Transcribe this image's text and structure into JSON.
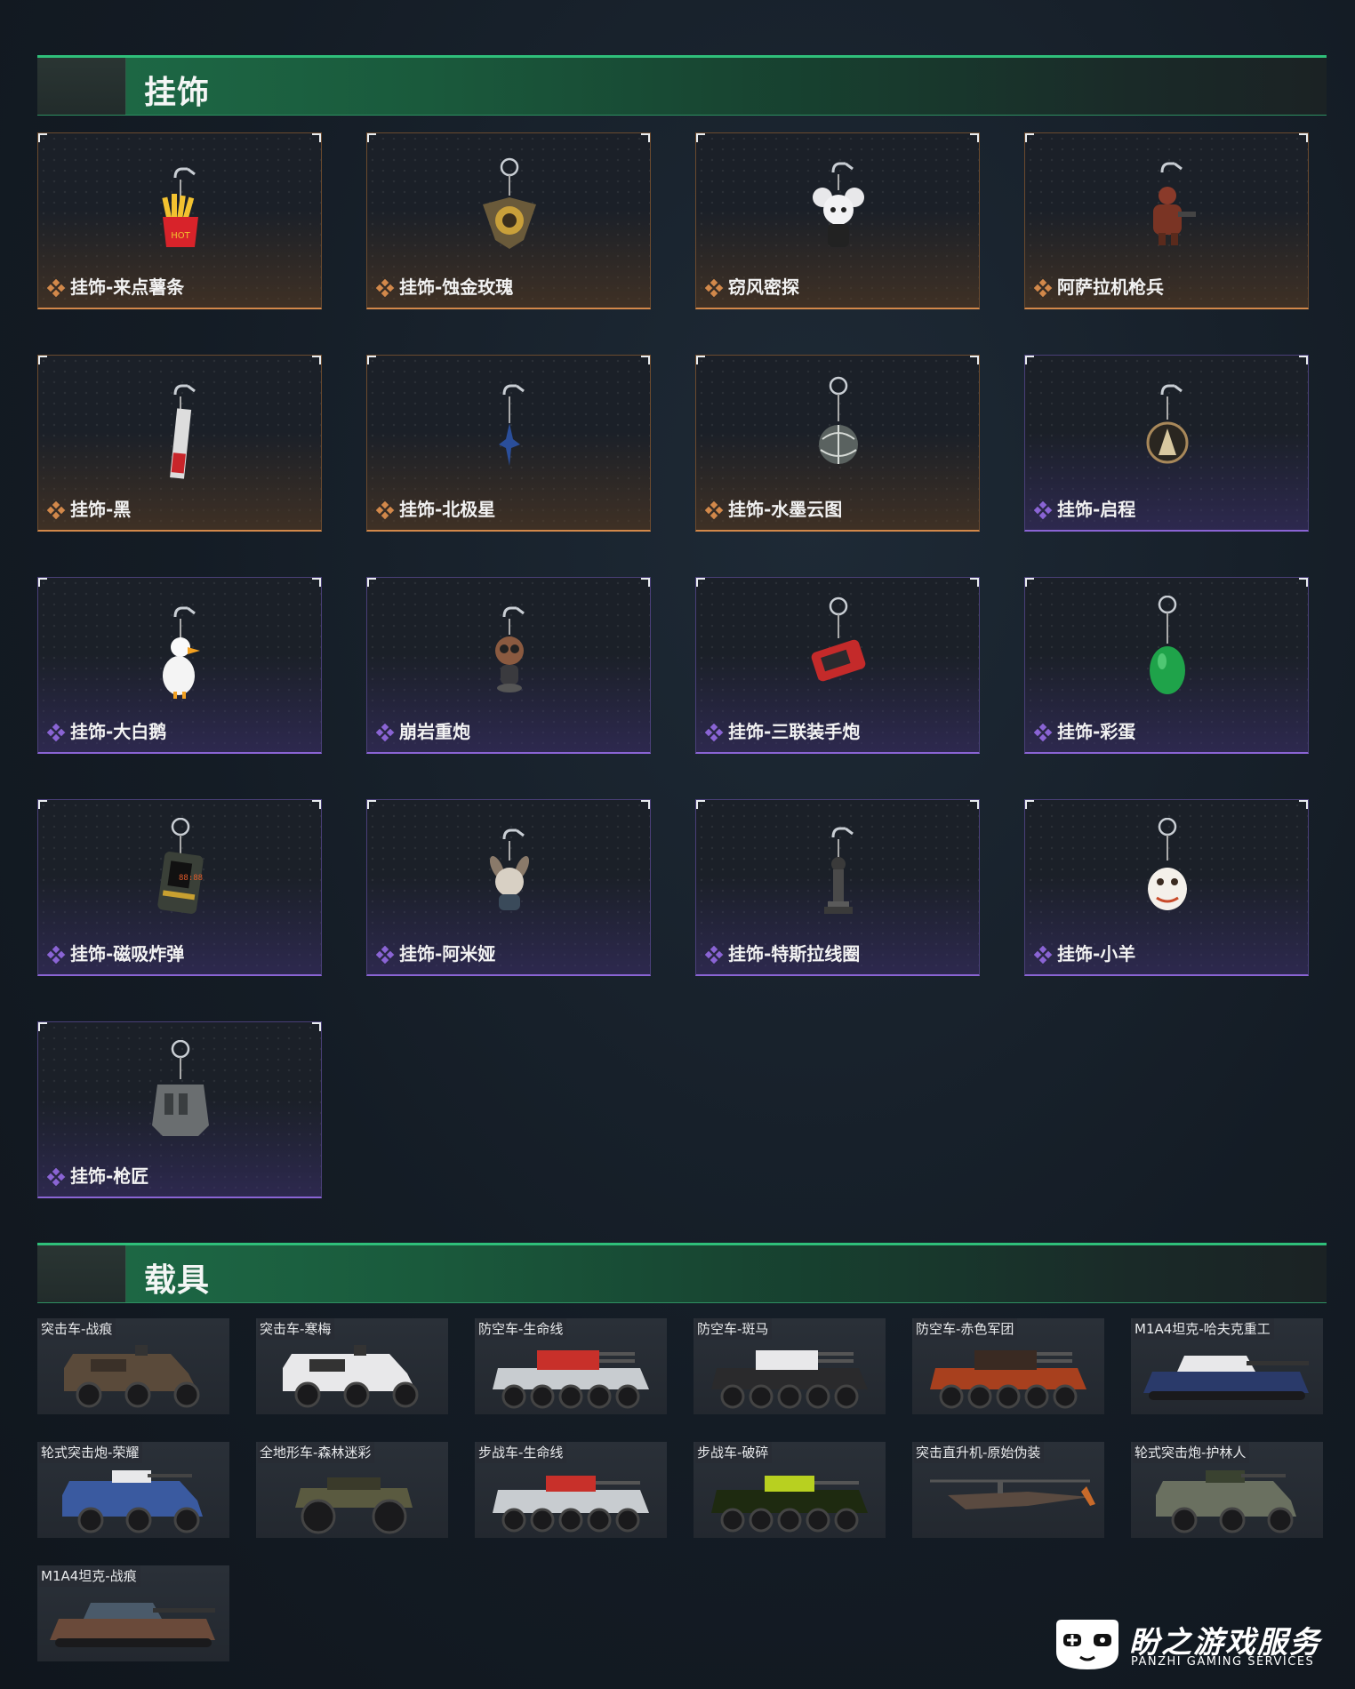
{
  "sections": {
    "charms_title": "挂饰",
    "vehicles_title": "载具"
  },
  "colors": {
    "accent_green": "#2fbf7a",
    "orange_rarity": "#d2884a",
    "purple_rarity": "#8a64d4"
  },
  "charms": [
    {
      "label": "挂饰-来点薯条",
      "rarity": "orange",
      "icon": "fries-charm-icon"
    },
    {
      "label": "挂饰-蚀金玫瑰",
      "rarity": "orange",
      "icon": "rose-charm-icon"
    },
    {
      "label": "窃风密探",
      "rarity": "orange",
      "icon": "mouse-spy-charm-icon"
    },
    {
      "label": "阿萨拉机枪兵",
      "rarity": "orange",
      "icon": "gunner-charm-icon"
    },
    {
      "label": "挂饰-黑",
      "rarity": "orange",
      "icon": "black-tag-charm-icon"
    },
    {
      "label": "挂饰-北极星",
      "rarity": "orange",
      "icon": "polaris-charm-icon"
    },
    {
      "label": "挂饰-水墨云图",
      "rarity": "orange",
      "icon": "ink-sphere-charm-icon"
    },
    {
      "label": "挂饰-启程",
      "rarity": "purple",
      "icon": "departure-charm-icon"
    },
    {
      "label": "挂饰-大白鹅",
      "rarity": "purple",
      "icon": "goose-charm-icon"
    },
    {
      "label": "崩岩重炮",
      "rarity": "purple",
      "icon": "cannon-bird-charm-icon"
    },
    {
      "label": "挂饰-三联装手炮",
      "rarity": "purple",
      "icon": "hand-cannon-charm-icon"
    },
    {
      "label": "挂饰-彩蛋",
      "rarity": "purple",
      "icon": "green-egg-charm-icon"
    },
    {
      "label": "挂饰-磁吸炸弹",
      "rarity": "purple",
      "icon": "magnet-bomb-charm-icon"
    },
    {
      "label": "挂饰-阿米娅",
      "rarity": "purple",
      "icon": "amiya-charm-icon"
    },
    {
      "label": "挂饰-特斯拉线圈",
      "rarity": "purple",
      "icon": "tesla-coil-charm-icon"
    },
    {
      "label": "挂饰-小羊",
      "rarity": "purple",
      "icon": "lamb-charm-icon"
    },
    {
      "label": "挂饰-枪匠",
      "rarity": "purple",
      "icon": "gunsmith-charm-icon"
    }
  ],
  "vehicles": [
    {
      "label": "突击车-战痕",
      "icon": "assault-car-icon"
    },
    {
      "label": "突击车-寒梅",
      "icon": "assault-car-icon"
    },
    {
      "label": "防空车-生命线",
      "icon": "aa-vehicle-icon"
    },
    {
      "label": "防空车-斑马",
      "icon": "aa-vehicle-icon"
    },
    {
      "label": "防空车-赤色军团",
      "icon": "aa-vehicle-icon"
    },
    {
      "label": "M1A4坦克-哈夫克重工",
      "icon": "tank-icon"
    },
    {
      "label": "轮式突击炮-荣耀",
      "icon": "wheeled-gun-icon"
    },
    {
      "label": "全地形车-森林迷彩",
      "icon": "atv-icon"
    },
    {
      "label": "步战车-生命线",
      "icon": "ifv-icon"
    },
    {
      "label": "步战车-破碎",
      "icon": "ifv-icon"
    },
    {
      "label": "突击直升机-原始伪装",
      "icon": "helicopter-icon"
    },
    {
      "label": "轮式突击炮-护林人",
      "icon": "wheeled-gun-icon"
    },
    {
      "label": "M1A4坦克-战痕",
      "icon": "tank-icon"
    }
  ],
  "watermark": {
    "brand": "盼之游戏服务",
    "sub": "PANZHI GAMING SERVICES"
  }
}
